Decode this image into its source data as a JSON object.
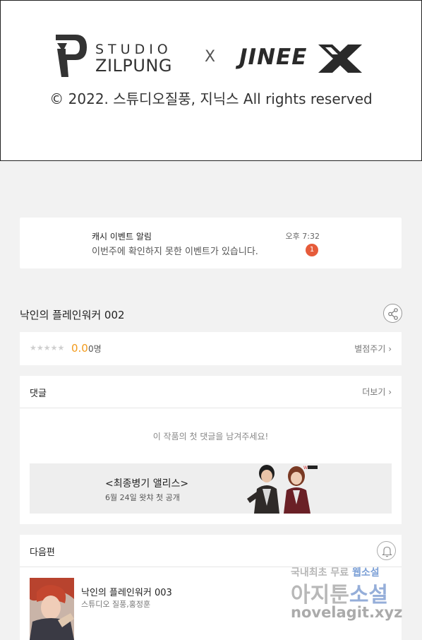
{
  "banner": {
    "studio_top": "STUDIO",
    "studio_bottom": "ZILPUNG",
    "collab_mark": "X",
    "partner": "JINEE",
    "copyright": "© 2022. 스튜디오질풍, 지닉스 All rights reserved"
  },
  "notice": {
    "title": "캐시 이벤트 알림",
    "body": "이번주에 확인하지 못한 이벤트가 있습니다.",
    "time": "오후 7:32",
    "badge": "1",
    "badge_color": "#e65b3a"
  },
  "episode": {
    "title": "낙인의 플레인워커 002",
    "share_icon": "share-icon"
  },
  "rating": {
    "stars": "★★★★★",
    "score": "0.0",
    "count": "0명",
    "rate_link": "별점주기 ›",
    "score_color": "#f29a1b"
  },
  "comments": {
    "title": "댓글",
    "more": "더보기 ›",
    "empty": "이 작품의 첫 댓글을 남겨주세요!"
  },
  "ad": {
    "title": "<최종병기 앨리스>",
    "subtitle": "6월 24일 왓챠 첫 공개"
  },
  "next": {
    "title": "다음편",
    "episode": "낙인의 플레인워커 003",
    "authors": "스튜디오 질풍,홍정훈",
    "bell_icon": "bell-icon"
  },
  "watermark": {
    "line1_a": "국내최초 무료 ",
    "line1_b": "웹소설",
    "line2_a": "아지툰",
    "line2_b": "소설",
    "line3": "novelagit.xyz"
  }
}
